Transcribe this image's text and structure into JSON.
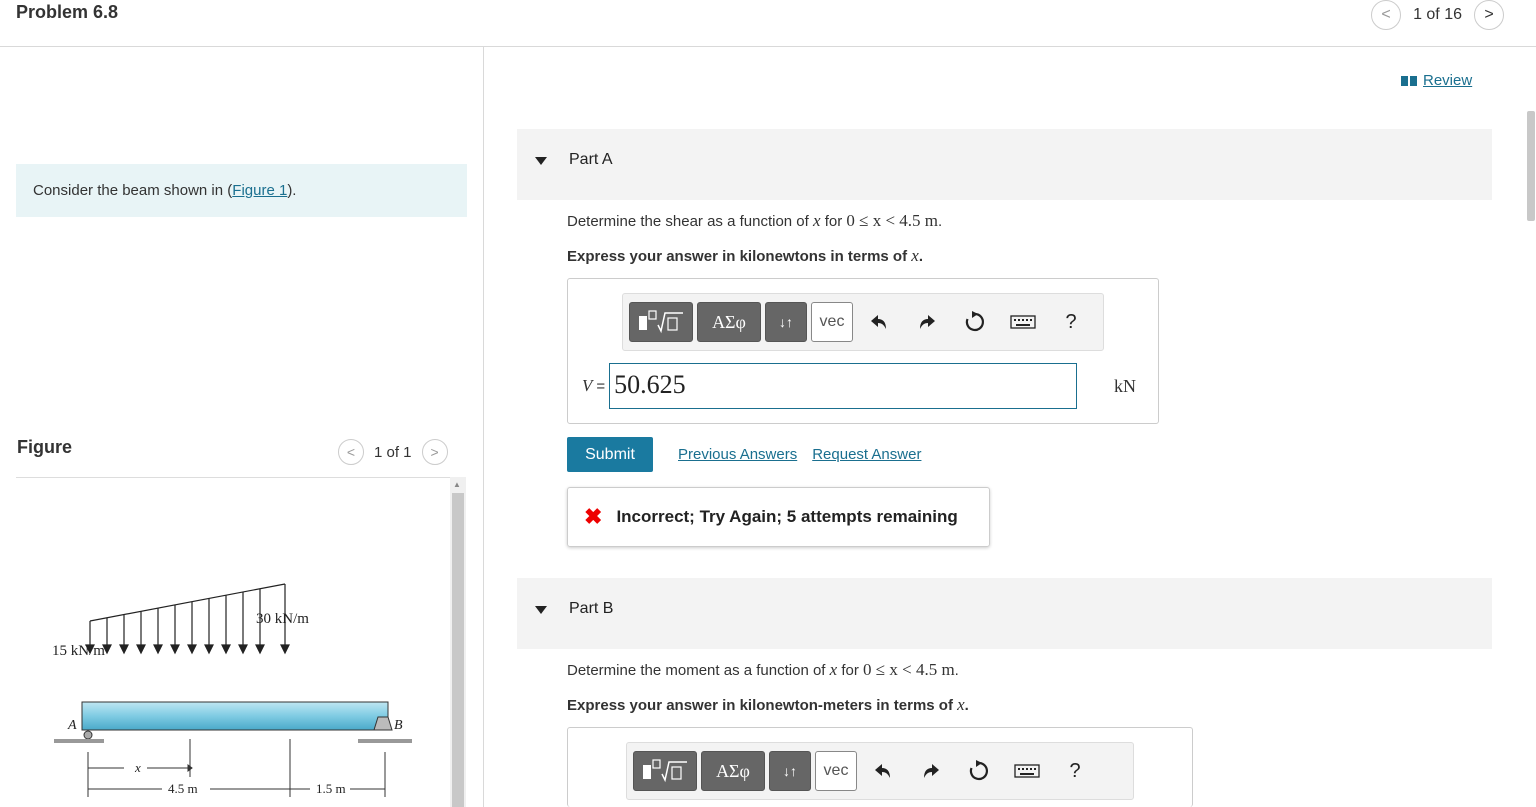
{
  "header": {
    "title": "Problem 6.8",
    "pager_text": "1 of 16",
    "prev_glyph": "<",
    "next_glyph": ">"
  },
  "intro": {
    "text_prefix": "Consider the beam shown in (",
    "link": "Figure 1",
    "text_suffix": ")."
  },
  "figure": {
    "label": "Figure",
    "pager_text": "1 of 1",
    "prev_glyph": "<",
    "next_glyph": ">",
    "load_right": "30 kN/m",
    "load_left": "15 kN/m",
    "point_a": "A",
    "point_b": "B",
    "x_label": "x",
    "dim_left": "4.5 m",
    "dim_right": "1.5 m"
  },
  "review": {
    "label": "Review"
  },
  "partA": {
    "label": "Part A",
    "question_prefix": "Determine the shear as a function of ",
    "question_var": "x",
    "question_mid": " for ",
    "question_math": "0 ≤ x < 4.5 m",
    "question_end": ".",
    "instruction_prefix": "Express your answer in kilonewtons in terms of ",
    "instruction_var": "x",
    "instruction_end": ".",
    "toolbar": {
      "greek": "ΑΣφ",
      "sort": "↓↑",
      "vec": "vec",
      "help": "?"
    },
    "variable": "V",
    "equals": "=",
    "input_value": "50.625",
    "unit": "kN",
    "submit": "Submit",
    "previous_answers": "Previous Answers",
    "request_answer": "Request Answer",
    "feedback": "Incorrect; Try Again; 5 attempts remaining"
  },
  "partB": {
    "label": "Part B",
    "question_prefix": "Determine the moment as a function of ",
    "question_var": "x",
    "question_mid": " for ",
    "question_math": "0 ≤ x < 4.5 m",
    "question_end": ".",
    "instruction_prefix": "Express your answer in kilonewton-meters in terms of ",
    "instruction_var": "x",
    "instruction_end": ".",
    "toolbar": {
      "greek": "ΑΣφ",
      "sort": "↓↑",
      "vec": "vec",
      "help": "?"
    }
  },
  "colors": {
    "accent": "#1a7aa0",
    "link": "#1a6f8f",
    "intro_bg": "#e8f4f6",
    "error": "#e00000"
  }
}
